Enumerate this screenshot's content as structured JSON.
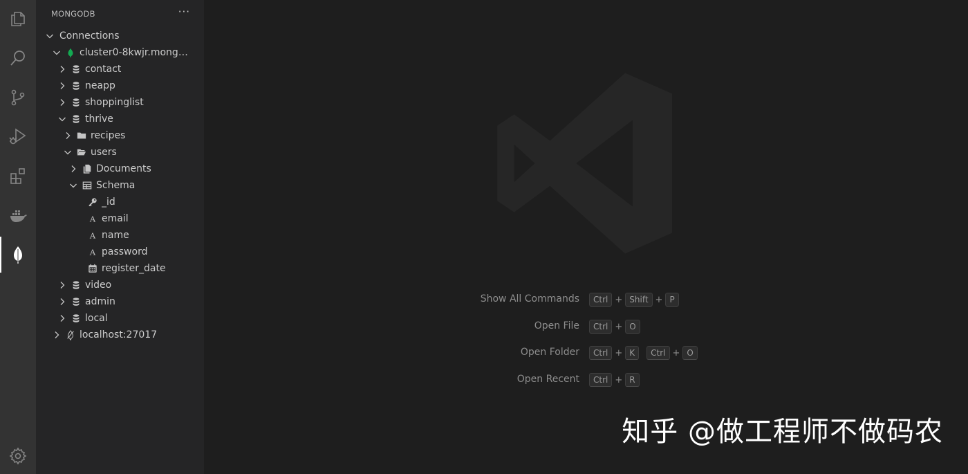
{
  "sidebar": {
    "title": "MONGODB",
    "more_label": "···",
    "tree": [
      {
        "label": "Connections",
        "icon": "none",
        "expanded": true,
        "depth": 0
      },
      {
        "label": "cluster0-8kwjr.mongod...",
        "icon": "leaf-icon",
        "expanded": true,
        "depth": 1
      },
      {
        "label": "contact",
        "icon": "database-icon",
        "expanded": false,
        "depth": 2
      },
      {
        "label": "neapp",
        "icon": "database-icon",
        "expanded": false,
        "depth": 2
      },
      {
        "label": "shoppinglist",
        "icon": "database-icon",
        "expanded": false,
        "depth": 2
      },
      {
        "label": "thrive",
        "icon": "database-icon",
        "expanded": true,
        "depth": 2
      },
      {
        "label": "recipes",
        "icon": "folder-icon",
        "expanded": false,
        "depth": 3
      },
      {
        "label": "users",
        "icon": "folder-open-icon",
        "expanded": true,
        "depth": 3
      },
      {
        "label": "Documents",
        "icon": "documents-icon",
        "expanded": false,
        "depth": 4
      },
      {
        "label": "Schema",
        "icon": "table-icon",
        "expanded": true,
        "depth": 4
      },
      {
        "label": "_id",
        "icon": "key-icon",
        "leaf": true,
        "depth": 5
      },
      {
        "label": "email",
        "icon": "string-type-icon",
        "leaf": true,
        "depth": 5
      },
      {
        "label": "name",
        "icon": "string-type-icon",
        "leaf": true,
        "depth": 5
      },
      {
        "label": "password",
        "icon": "string-type-icon",
        "leaf": true,
        "depth": 5
      },
      {
        "label": "register_date",
        "icon": "calendar-icon",
        "leaf": true,
        "depth": 5
      },
      {
        "label": "video",
        "icon": "database-icon",
        "expanded": false,
        "depth": 2
      },
      {
        "label": "admin",
        "icon": "database-icon",
        "expanded": false,
        "depth": 2
      },
      {
        "label": "local",
        "icon": "database-icon",
        "expanded": false,
        "depth": 2
      },
      {
        "label": "localhost:27017",
        "icon": "disconnected-leaf-icon",
        "expanded": false,
        "depth": 1
      }
    ]
  },
  "activity_bar": [
    {
      "name": "explorer-icon",
      "active": false
    },
    {
      "name": "search-icon",
      "active": false
    },
    {
      "name": "source-control-icon",
      "active": false
    },
    {
      "name": "run-debug-icon",
      "active": false
    },
    {
      "name": "extensions-icon",
      "active": false
    },
    {
      "name": "docker-icon",
      "active": false
    },
    {
      "name": "mongodb-icon",
      "active": true
    },
    {
      "name": "settings-gear-icon",
      "active": false
    }
  ],
  "editor": {
    "watermark_icon": "vscode-logo-icon",
    "shortcuts": [
      {
        "label": "Show All Commands",
        "combos": [
          [
            "Ctrl",
            "Shift",
            "P"
          ]
        ]
      },
      {
        "label": "Open File",
        "combos": [
          [
            "Ctrl",
            "O"
          ]
        ]
      },
      {
        "label": "Open Folder",
        "combos": [
          [
            "Ctrl",
            "K"
          ],
          [
            "Ctrl",
            "O"
          ]
        ]
      },
      {
        "label": "Open Recent",
        "combos": [
          [
            "Ctrl",
            "R"
          ]
        ]
      }
    ],
    "brand_watermark": "知乎 @做工程师不做码农"
  },
  "colors": {
    "activity_bar": "#333333",
    "sidebar": "#252526",
    "editor": "#1e1e1e",
    "mongo_green": "#13aa52"
  }
}
